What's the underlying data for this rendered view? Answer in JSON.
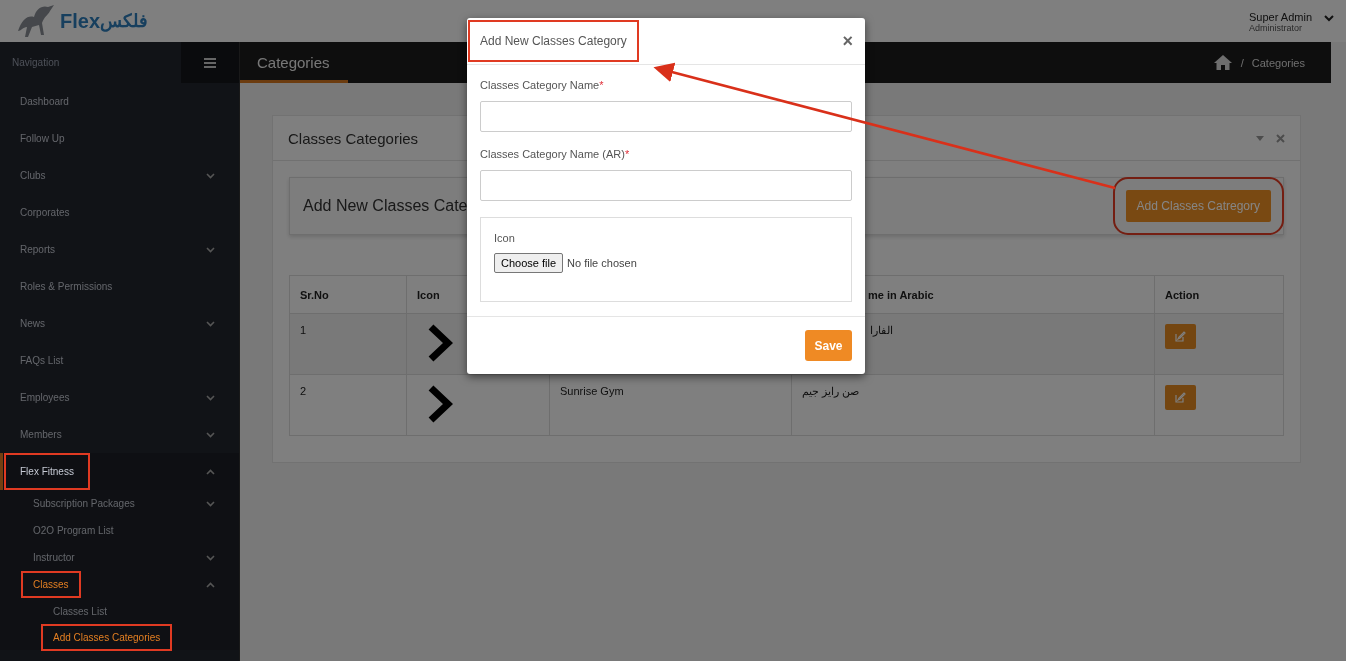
{
  "header": {
    "logo_text": "Flex",
    "logo_text_ar": "فلكس",
    "user_name": "Super Admin",
    "user_role": "Administrator"
  },
  "sidebar": {
    "heading": "Navigation",
    "items": [
      {
        "label": "Dashboard",
        "kind": "link",
        "active": false,
        "highlighted": false
      },
      {
        "label": "Follow Up",
        "kind": "link",
        "active": false,
        "highlighted": false
      },
      {
        "label": "Clubs",
        "kind": "group",
        "expanded": false,
        "active": false,
        "highlighted": false
      },
      {
        "label": "Corporates",
        "kind": "link",
        "active": false,
        "highlighted": false
      },
      {
        "label": "Reports",
        "kind": "group",
        "expanded": false,
        "active": false,
        "highlighted": false
      },
      {
        "label": "Roles & Permissions",
        "kind": "link",
        "active": false,
        "highlighted": false
      },
      {
        "label": "News",
        "kind": "group",
        "expanded": false,
        "active": false,
        "highlighted": false
      },
      {
        "label": "FAQs List",
        "kind": "link",
        "active": false,
        "highlighted": false
      },
      {
        "label": "Employees",
        "kind": "group",
        "expanded": false,
        "active": false,
        "highlighted": false
      },
      {
        "label": "Members",
        "kind": "group",
        "expanded": false,
        "active": false,
        "highlighted": false
      },
      {
        "label": "Flex Fitness",
        "kind": "group",
        "expanded": true,
        "active": false,
        "highlighted": true,
        "children": [
          {
            "label": "Subscription Packages",
            "kind": "group",
            "expanded": false,
            "active": false,
            "highlighted": false
          },
          {
            "label": "O2O Program List",
            "kind": "link",
            "active": false,
            "highlighted": false
          },
          {
            "label": "Instructor",
            "kind": "group",
            "expanded": false,
            "active": false,
            "highlighted": false
          },
          {
            "label": "Classes",
            "kind": "group",
            "expanded": true,
            "active": true,
            "highlighted": true,
            "children": [
              {
                "label": "Classes List",
                "kind": "link",
                "active": false,
                "highlighted": false
              },
              {
                "label": "Add Classes Categories",
                "kind": "link",
                "active": true,
                "highlighted": true
              }
            ]
          }
        ]
      }
    ]
  },
  "topbar": {
    "title": "Categories",
    "breadcrumb": [
      {
        "kind": "home"
      },
      {
        "kind": "separator",
        "label": "/"
      },
      {
        "kind": "text",
        "label": "Categories"
      }
    ]
  },
  "panel": {
    "title": "Classes Categories",
    "card_title": "Add New Classes Cate",
    "add_button": {
      "label": "Add Classes Catregory",
      "highlighted": true
    },
    "table": {
      "columns": [
        {
          "label": "Sr.No"
        },
        {
          "label": "Icon"
        },
        {},
        {
          "label": "me in Arabic"
        },
        {
          "label": "Action"
        }
      ],
      "rows": [
        {
          "sr": "1",
          "name_ar": "الفارا"
        },
        {
          "sr": "2",
          "name": "Sunrise Gym",
          "name_ar": "صن رايز جيم"
        }
      ]
    }
  },
  "modal": {
    "title": "Add New Classes Category",
    "title_highlighted": true,
    "close": "×",
    "fields": [
      {
        "label": "Classes Category Name",
        "required_mark": "*",
        "kind": "text"
      },
      {
        "label": "Classes Category Name (AR)",
        "required_mark": "*",
        "kind": "text"
      },
      {
        "label": "Icon",
        "kind": "file",
        "button": "Choose file",
        "status": "No file chosen"
      }
    ],
    "save": "Save"
  }
}
